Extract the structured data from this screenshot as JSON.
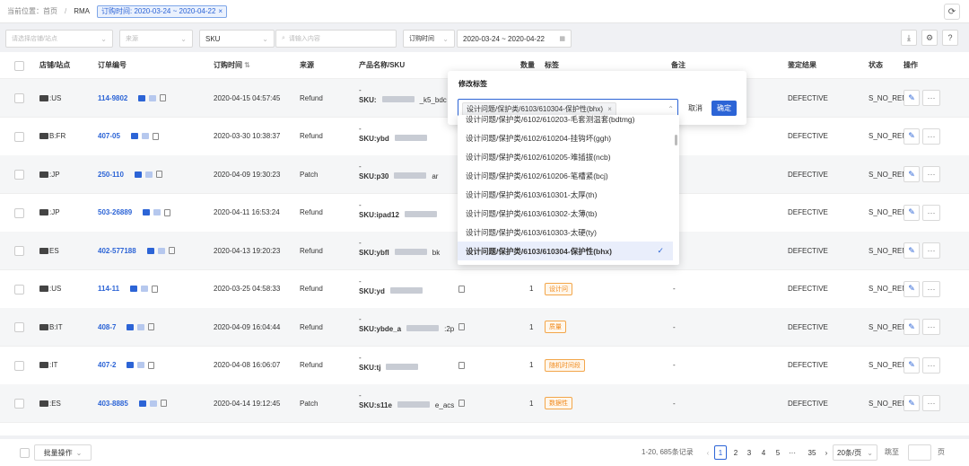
{
  "breadcrumb": {
    "home": "当前位置：首页",
    "current": "RMA"
  },
  "active_filter": "订购时间: 2020-03-24 ~ 2020-04-22",
  "filters": {
    "shop_placeholder": "请选择店铺/站点",
    "source_placeholder": "来源",
    "sku_label": "SKU",
    "search_placeholder": "请输入内容",
    "time_type": "订购时间",
    "date_range": "2020-03-24 ~ 2020-04-22"
  },
  "columns": {
    "shop": "店铺/站点",
    "order_no": "订单编号",
    "order_time": "订购时间",
    "source": "来源",
    "product": "产品名称/SKU",
    "qty": "数量",
    "tag": "标签",
    "note": "备注",
    "result": "鉴定结果",
    "status": "状态",
    "ops": "操作"
  },
  "rows": [
    {
      "shop": ":US",
      "order": "114-9802",
      "time": "2020-04-15 04:57:45",
      "source": "Refund",
      "sku": "SKU:",
      "sku_tail": "_k5_bdc",
      "qty": "",
      "tag": "",
      "note": "",
      "result": "DEFECTIVE",
      "status": "S_NO_REN"
    },
    {
      "shop": "B:FR",
      "order": "407-05",
      "time": "2020-03-30 10:38:37",
      "source": "Refund",
      "sku": "SKU:ybd",
      "sku_tail": "",
      "qty": "",
      "tag": "",
      "note": "",
      "result": "DEFECTIVE",
      "status": "S_NO_REN"
    },
    {
      "shop": ":JP",
      "order": "250-110",
      "time": "2020-04-09 19:30:23",
      "source": "Patch",
      "sku": "SKU:p30",
      "sku_tail": "ar",
      "qty": "",
      "tag": "",
      "note": "",
      "result": "DEFECTIVE",
      "status": "S_NO_REN"
    },
    {
      "shop": ":JP",
      "order": "503-26889",
      "time": "2020-04-11 16:53:24",
      "source": "Refund",
      "sku": "SKU:ipad12",
      "sku_tail": "",
      "qty": "",
      "tag": "",
      "note": "",
      "result": "DEFECTIVE",
      "status": "S_NO_REN"
    },
    {
      "shop": "ES",
      "order": "402-577188",
      "time": "2020-04-13 19:20:23",
      "source": "Refund",
      "sku": "SKU:ybfl",
      "sku_tail": "bk",
      "qty": "",
      "tag": "",
      "note": "",
      "result": "DEFECTIVE",
      "status": "S_NO_REN"
    },
    {
      "shop": ":US",
      "order": "114-11",
      "time": "2020-03-25 04:58:33",
      "source": "Refund",
      "sku": "SKU:yd",
      "sku_tail": "",
      "qty": "1",
      "tag": "设计问",
      "note": "-",
      "result": "DEFECTIVE",
      "status": "S_NO_REN"
    },
    {
      "shop": "B:IT",
      "order": "408-7",
      "time": "2020-04-09 16:04:44",
      "source": "Refund",
      "sku": "SKU:ybde_a",
      "sku_tail": ":2p",
      "qty": "1",
      "tag": "质量",
      "note": "-",
      "result": "DEFECTIVE",
      "status": "S_NO_REN"
    },
    {
      "shop": ":IT",
      "order": "407-2",
      "time": "2020-04-08 16:06:07",
      "source": "Refund",
      "sku": "SKU:tj",
      "sku_tail": "",
      "qty": "1",
      "tag": "随机时间段",
      "note": "-",
      "result": "DEFECTIVE",
      "status": "S_NO_REN"
    },
    {
      "shop": ":ES",
      "order": "403-8885",
      "time": "2020-04-14 19:12:45",
      "source": "Patch",
      "sku": "SKU:s11e",
      "sku_tail": "e_acs",
      "qty": "1",
      "tag": "数据性",
      "note": "-",
      "result": "DEFECTIVE",
      "status": "S_NO_REN"
    }
  ],
  "popover": {
    "title": "修改标签",
    "selected_tag": "设计问题/保护类/6103/610304-保护性(bhx)",
    "cancel": "取消",
    "ok": "确定"
  },
  "dropdown_options": [
    {
      "label": "设计问题/保护类/6102/610203-毛套测温套(bdtmg)",
      "selected": false
    },
    {
      "label": "设计问题/保护类/6102/610204-挂钩坏(ggh)",
      "selected": false
    },
    {
      "label": "设计问题/保护类/6102/610205-难插拔(ncb)",
      "selected": false
    },
    {
      "label": "设计问题/保护类/6102/610206-笔槽紧(bcj)",
      "selected": false
    },
    {
      "label": "设计问题/保护类/6103/610301-太厚(th)",
      "selected": false
    },
    {
      "label": "设计问题/保护类/6103/610302-太薄(tb)",
      "selected": false
    },
    {
      "label": "设计问题/保护类/6103/610303-太硬(ty)",
      "selected": false
    },
    {
      "label": "设计问题/保护类/6103/610304-保护性(bhx)",
      "selected": true
    }
  ],
  "footer": {
    "batch": "批量操作",
    "summary": "1-20, 685条记录",
    "pages": [
      "1",
      "2",
      "3",
      "4",
      "5",
      "···",
      "35"
    ],
    "page_size": "20条/页",
    "goto": "跳至",
    "page_unit": "页"
  },
  "colors": {
    "accent": "#2c64d6",
    "tag_orange": "#f08a1c"
  }
}
